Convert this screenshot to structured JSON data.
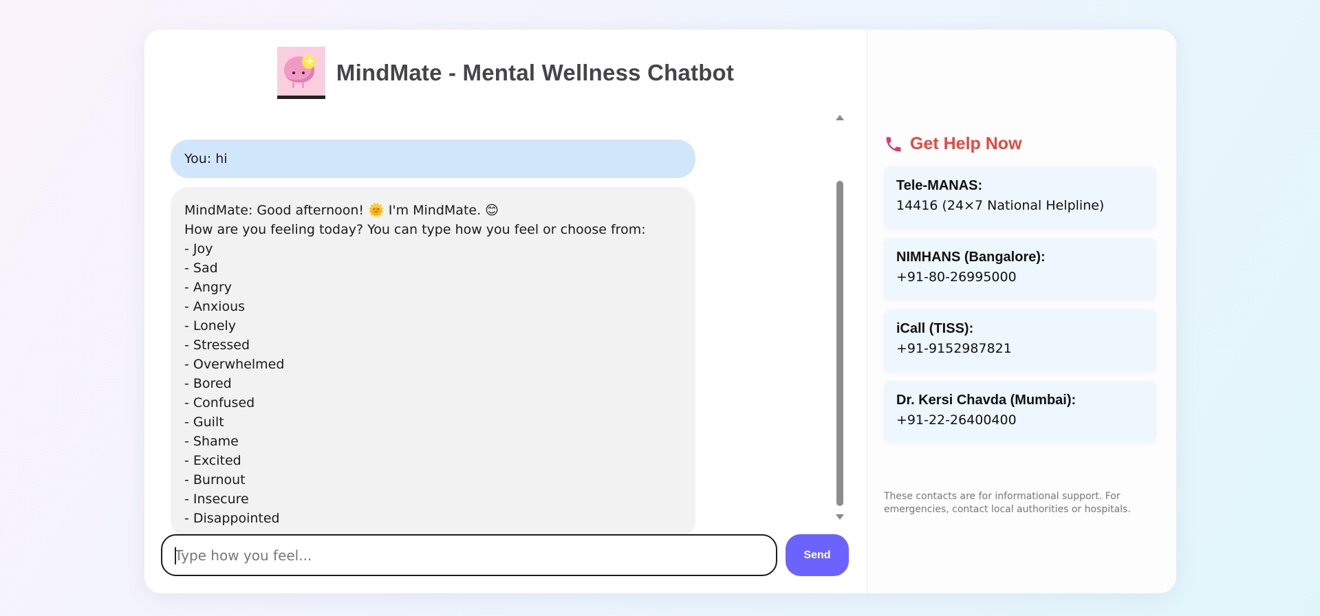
{
  "header": {
    "title": "MindMate - Mental Wellness Chatbot",
    "logo_icon": "brain-with-lightbulb-icon"
  },
  "chat": {
    "messages": [
      {
        "role": "user",
        "text": "You: hi"
      },
      {
        "role": "bot",
        "text": "MindMate: Good afternoon! 🌞 I'm MindMate. 😊\nHow are you feeling today? You can type how you feel or choose from:\n- Joy\n- Sad\n- Angry\n- Anxious\n- Lonely\n- Stressed\n- Overwhelmed\n- Bored\n- Confused\n- Guilt\n- Shame\n- Excited\n- Burnout\n- Insecure\n- Disappointed"
      }
    ],
    "input_placeholder": "Type how you feel...",
    "input_value": "",
    "send_label": "Send"
  },
  "help": {
    "title": "Get Help Now",
    "icon": "telephone-icon",
    "title_color": "#e5483f",
    "contacts": [
      {
        "name": "Tele-MANAS:",
        "number": "14416 (24×7 National Helpline)"
      },
      {
        "name": "NIMHANS (Bangalore):",
        "number": "+91-80-26995000"
      },
      {
        "name": "iCall (TISS):",
        "number": "+91-9152987821"
      },
      {
        "name": "Dr. Kersi Chavda (Mumbai):",
        "number": "+91-22-26400400"
      }
    ],
    "disclaimer": "These contacts are for informational support. For emergencies, contact local authorities or hospitals."
  },
  "colors": {
    "accent": "#6c63ff",
    "user_bubble": "#d2e6fb",
    "bot_bubble": "#f2f2f2",
    "contact_card": "#eef6fe"
  }
}
